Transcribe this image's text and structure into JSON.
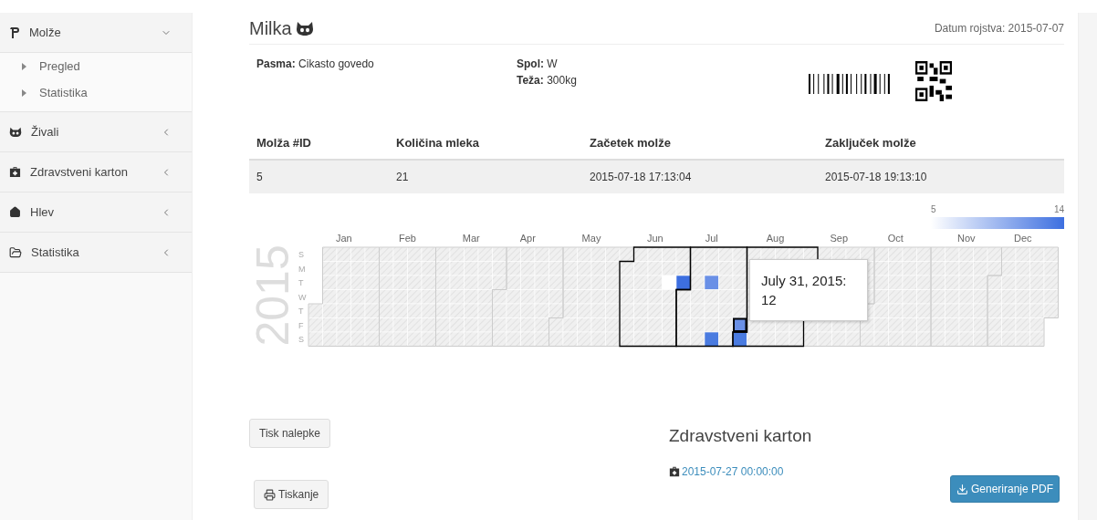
{
  "sidebar": {
    "items": [
      {
        "label": "Molže",
        "expanded": true,
        "children": [
          {
            "label": "Pregled"
          },
          {
            "label": "Statistika"
          }
        ]
      },
      {
        "label": "Živali",
        "expanded": false
      },
      {
        "label": "Zdravstveni karton",
        "expanded": false
      },
      {
        "label": "Hlev",
        "expanded": false
      },
      {
        "label": "Statistika",
        "expanded": false
      }
    ]
  },
  "header": {
    "title": "Milka",
    "birth_date": "Datum rojstva: 2015-07-07"
  },
  "info": [
    {
      "label": "Pasma:",
      "value": "Cikasto govedo"
    },
    {
      "label": "Spol:",
      "value": "W"
    },
    {
      "label": "Teža:",
      "value": "300kg"
    }
  ],
  "table": {
    "columns": [
      "Molža #ID",
      "Količina mleka",
      "Začetek molže",
      "Zaključek molže"
    ],
    "rows": [
      [
        "5",
        "21",
        "2015-07-18 17:13:04",
        "2015-07-18 19:13:10"
      ]
    ]
  },
  "calendar": {
    "year": "2015",
    "legend_min": "5",
    "legend_max": "14",
    "days": [
      "S",
      "M",
      "T",
      "W",
      "T",
      "F",
      "S"
    ],
    "months": [
      {
        "label": "Jan",
        "highlighted": false
      },
      {
        "label": "Feb",
        "highlighted": false
      },
      {
        "label": "Mar",
        "highlighted": false
      },
      {
        "label": "Apr",
        "highlighted": false
      },
      {
        "label": "May",
        "highlighted": false
      },
      {
        "label": "Jun",
        "highlighted": true
      },
      {
        "label": "Jul",
        "highlighted": true
      },
      {
        "label": "Aug",
        "highlighted": true
      },
      {
        "label": "Sep",
        "highlighted": false
      },
      {
        "label": "Oct",
        "highlighted": false
      },
      {
        "label": "Nov",
        "highlighted": false
      },
      {
        "label": "Dec",
        "highlighted": false
      }
    ],
    "tooltip": [
      "July 31, 2015:",
      "12"
    ]
  },
  "buttons": {
    "label_print": "Tisk nalepke",
    "print": "Tiskanje",
    "pdf": "Generiranje PDF"
  },
  "health": {
    "title": "Zdravstveni karton",
    "entry": "2015-07-27 00:00:00"
  }
}
